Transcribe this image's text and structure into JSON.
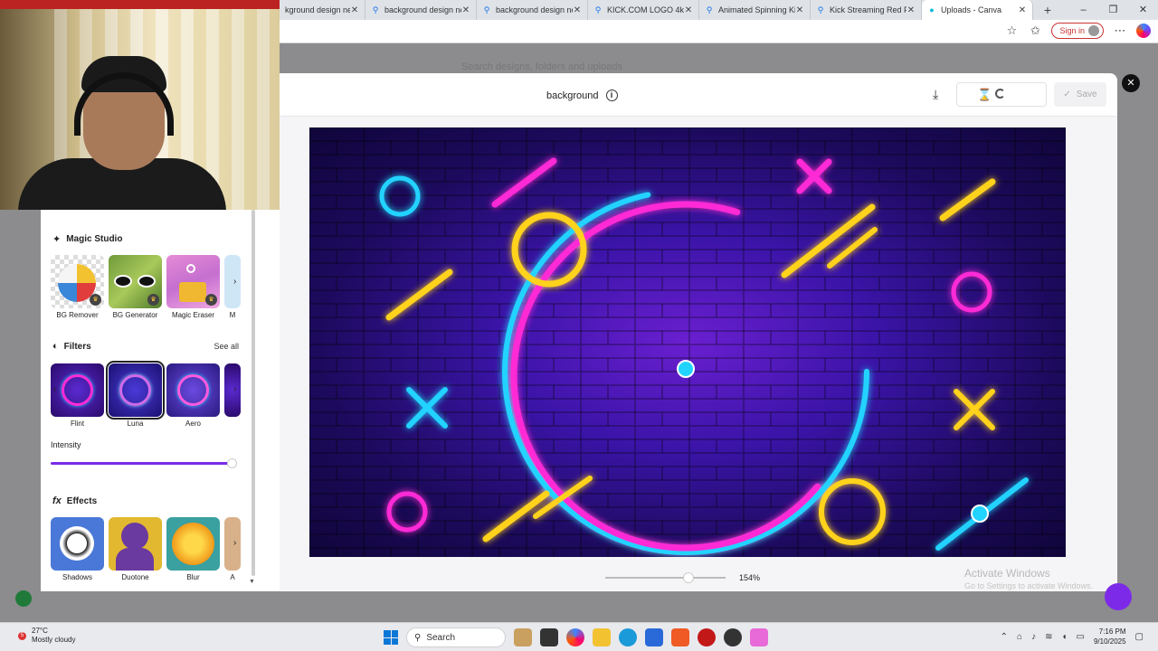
{
  "browser": {
    "tabs": [
      {
        "label": "kground design ne"
      },
      {
        "label": "background design ne"
      },
      {
        "label": "background design ne"
      },
      {
        "label": "KICK.COM LOGO 4k"
      },
      {
        "label": "Animated Spinning Kic"
      },
      {
        "label": "Kick Streaming Red PN"
      },
      {
        "label": "Uploads - Canva"
      }
    ],
    "sign_in": "Sign in"
  },
  "page": {
    "search_hint": "Search designs, folders and uploads"
  },
  "modal": {
    "file_name": "background",
    "save_label": "Save",
    "zoom": "154%"
  },
  "sidebar": {
    "magic_studio_title": "Magic Studio",
    "magic_items": [
      {
        "label": "BG Remover"
      },
      {
        "label": "BG Generator"
      },
      {
        "label": "Magic Eraser"
      },
      {
        "label": "M"
      }
    ],
    "filters_title": "Filters",
    "see_all": "See all",
    "filters": [
      {
        "label": "Flint"
      },
      {
        "label": "Luna"
      },
      {
        "label": "Aero"
      }
    ],
    "intensity_label": "Intensity",
    "intensity": 1.0,
    "effects_title": "Effects",
    "effects": [
      {
        "label": "Shadows"
      },
      {
        "label": "Duotone"
      },
      {
        "label": "Blur"
      },
      {
        "label": "A"
      }
    ]
  },
  "watermark": {
    "line1": "Activate Windows",
    "line2": "Go to Settings to activate Windows."
  },
  "taskbar": {
    "weather_temp": "27°C",
    "weather_desc": "Mostly cloudy",
    "search": "Search",
    "time": "7:16 PM",
    "date": "9/10/2025"
  },
  "colors": {
    "accent": "#7d2ae8",
    "neon_pink": "#ff2bd6",
    "neon_cyan": "#22d3ff",
    "neon_yellow": "#ffd21f"
  }
}
